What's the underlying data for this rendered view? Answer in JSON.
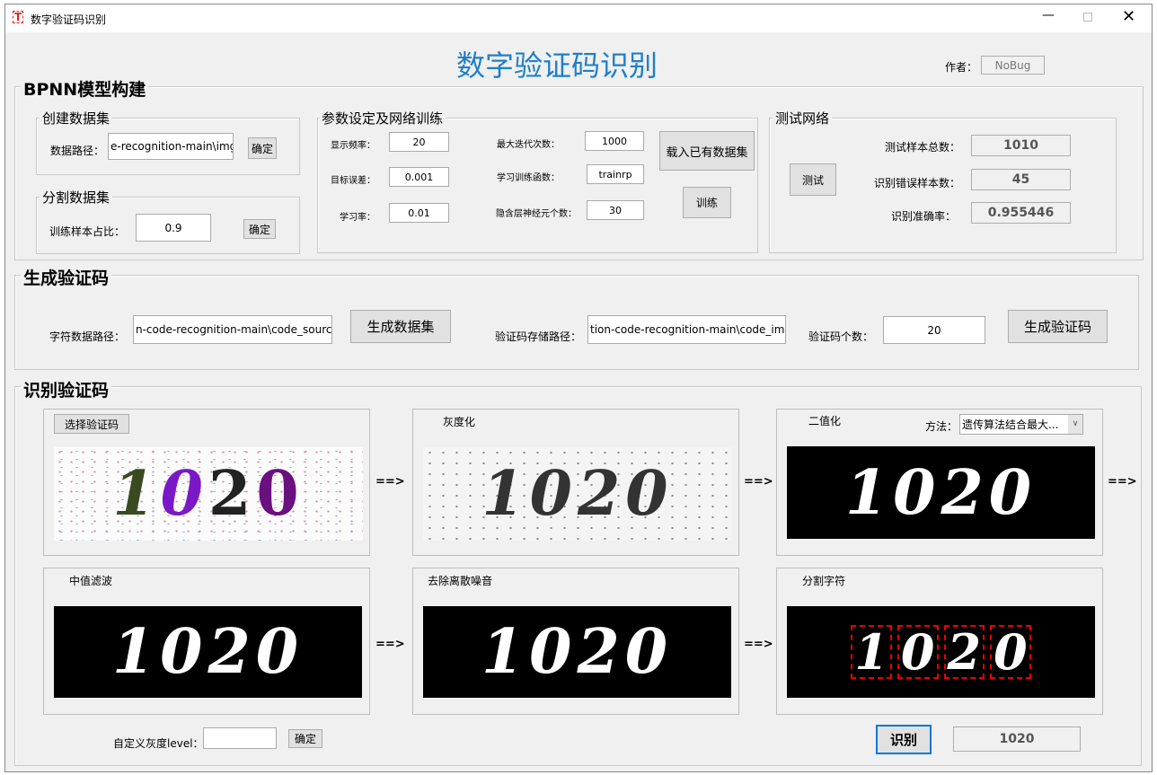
{
  "window": {
    "title": "数字验证码识别",
    "icon": "T"
  },
  "header": {
    "title": "数字验证码识别",
    "author_label": "作者：",
    "author": "NoBug"
  },
  "bpnn": {
    "title": "BPNN模型构建",
    "create": {
      "title": "创建数据集",
      "path_label": "数据路径：",
      "path_value": "e-recognition-main\\img\\",
      "confirm": "确定"
    },
    "split": {
      "title": "分割数据集",
      "ratio_label": "训练样本占比：",
      "ratio_value": "0.9",
      "confirm": "确定"
    },
    "params": {
      "title": "参数设定及网络训练",
      "show_freq_label": "显示频率：",
      "show_freq": "20",
      "goal_label": "目标误差：",
      "goal": "0.001",
      "lr_label": "学习率：",
      "lr": "0.01",
      "epochs_label": "最大迭代次数：",
      "epochs": "1000",
      "trainfcn_label": "学习训练函数：",
      "trainfcn": "trainrp",
      "hidden_label": "隐含层神经元个数：",
      "hidden": "30",
      "load_button": "载入已有数据集",
      "train_button": "训练"
    },
    "test": {
      "title": "测试网络",
      "test_button": "测试",
      "total_label": "测试样本总数：",
      "total": "1010",
      "errors_label": "识别错误样本数：",
      "errors": "45",
      "accuracy_label": "识别准确率：",
      "accuracy": "0.955446"
    }
  },
  "generate": {
    "title": "生成验证码",
    "char_path_label": "字符数据路径：",
    "char_path": "n-code-recognition-main\\code_source\\",
    "gen_dataset_button": "生成数据集",
    "store_path_label": "验证码存储路径：",
    "store_path": "tion-code-recognition-main\\code_img\\",
    "count_label": "验证码个数：",
    "count": "20",
    "gen_captcha_button": "生成验证码"
  },
  "recognize": {
    "title": "识别验证码",
    "select_button": "选择验证码",
    "gray_label": "灰度化",
    "binary_label": "二值化",
    "method_label": "方法：",
    "method_value": "遗传算法结合最大...",
    "median_label": "中值滤波",
    "denoise_label": "去除离散噪音",
    "segment_label": "分割字符",
    "arrow": "==>",
    "captcha_text": "1020",
    "digits": [
      "1",
      "0",
      "2",
      "0"
    ],
    "custom_gray_label": "自定义灰度level：",
    "custom_gray_value": "",
    "confirm": "确定",
    "recognize_button": "识别",
    "result": "1020"
  }
}
